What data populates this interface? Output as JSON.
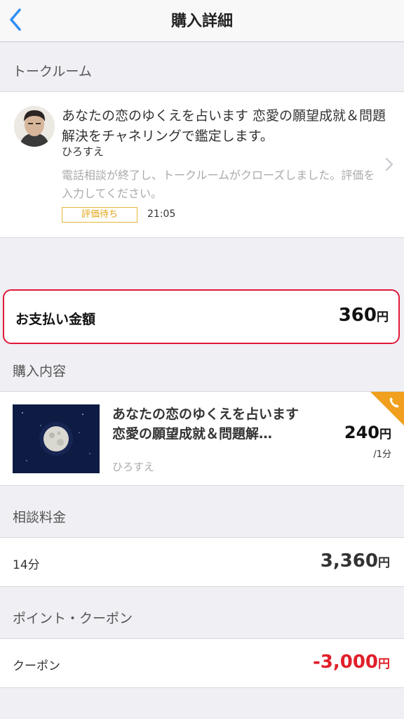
{
  "nav": {
    "title": "購入詳細",
    "back_icon": "chevron-left-icon",
    "accent_color": "#2f8ff5"
  },
  "talkroom": {
    "section_label": "トークルーム",
    "title": "あなたの恋のゆくえを占います 恋愛の願望成就＆問題解決をチャネリングで鑑定します。",
    "author": "ひろすえ",
    "message": "電話相談が終了し、トークルームがクローズしました。評価を入力してください。",
    "status_badge": "評価待ち",
    "time": "21:05"
  },
  "payment": {
    "label": "お支払い金額",
    "amount": "360",
    "currency": "円",
    "highlight_color": "#e0193a"
  },
  "purchase": {
    "section_label": "購入内容",
    "item": {
      "title": "あなたの恋のゆくえを占います 恋愛の願望成就＆問題解…",
      "author": "ひろすえ",
      "price": "240",
      "currency": "円",
      "unit": "/1分",
      "corner_icon": "phone-icon"
    }
  },
  "fee": {
    "section_label": "相談料金",
    "duration": "14分",
    "amount": "3,360",
    "currency": "円"
  },
  "points": {
    "section_label": "ポイント・クーポン",
    "coupon_label": "クーポン",
    "coupon_amount": "-3,000",
    "currency": "円",
    "discount_color": "#e01f2a"
  }
}
